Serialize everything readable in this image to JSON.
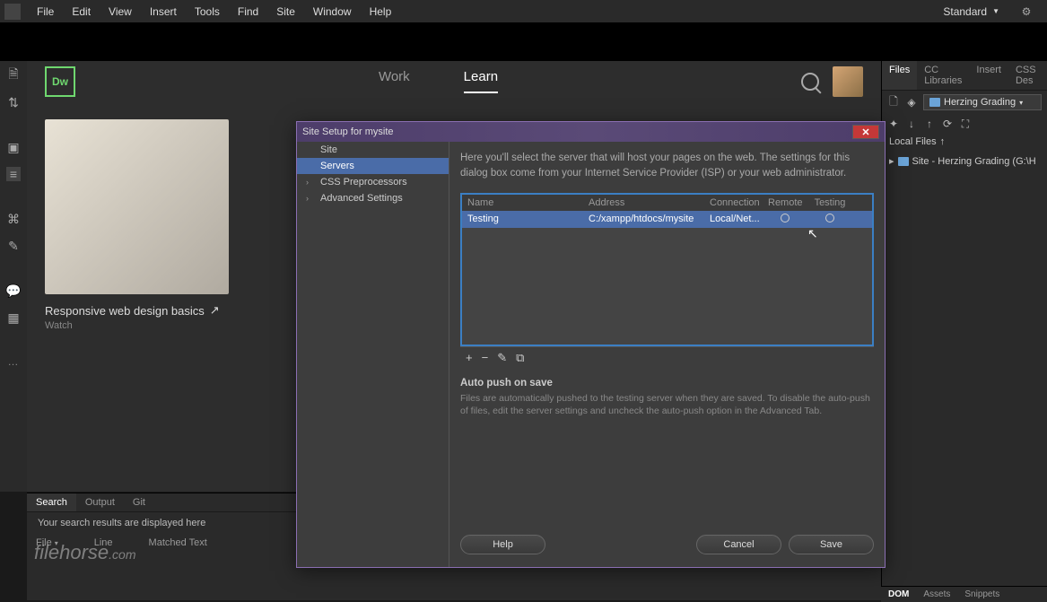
{
  "menubar": {
    "items": [
      "File",
      "Edit",
      "View",
      "Insert",
      "Tools",
      "Find",
      "Site",
      "Window",
      "Help"
    ],
    "workspace": "Standard"
  },
  "start": {
    "logo": "Dw",
    "tabs": {
      "work": "Work",
      "learn": "Learn"
    },
    "card": {
      "title": "Responsive web design basics",
      "sub": "Watch"
    }
  },
  "right_panel": {
    "tabs": [
      "Files",
      "CC Libraries",
      "Insert",
      "CSS Des"
    ],
    "site_dropdown": "Herzing Grading",
    "filter": "Local Files",
    "tree_root": "Site - Herzing Grading (G:\\H"
  },
  "search_panel": {
    "tabs": [
      "Search",
      "Output",
      "Git"
    ],
    "msg": "Your search results are displayed here",
    "cols": [
      "File",
      "Line",
      "Matched Text"
    ]
  },
  "bottom_tabs": [
    "DOM",
    "Assets",
    "Snippets"
  ],
  "dialog": {
    "title": "Site Setup for mysite",
    "sidebar": [
      "Site",
      "Servers",
      "CSS Preprocessors",
      "Advanced Settings"
    ],
    "desc": "Here you'll select the server that will host your pages on the web. The settings for this dialog box come from your Internet Service Provider (ISP) or your web administrator.",
    "headers": {
      "name": "Name",
      "addr": "Address",
      "conn": "Connection",
      "rem": "Remote",
      "test": "Testing"
    },
    "row": {
      "name": "Testing",
      "addr": "C:/xampp/htdocs/mysite",
      "conn": "Local/Net..."
    },
    "auto_push": {
      "title": "Auto push on save",
      "desc": "Files are automatically pushed to the testing server when they are saved. To disable the auto-push of files, edit the server settings and uncheck the auto-push option in the Advanced Tab."
    },
    "buttons": {
      "help": "Help",
      "cancel": "Cancel",
      "save": "Save"
    }
  },
  "watermark": "filehorse"
}
